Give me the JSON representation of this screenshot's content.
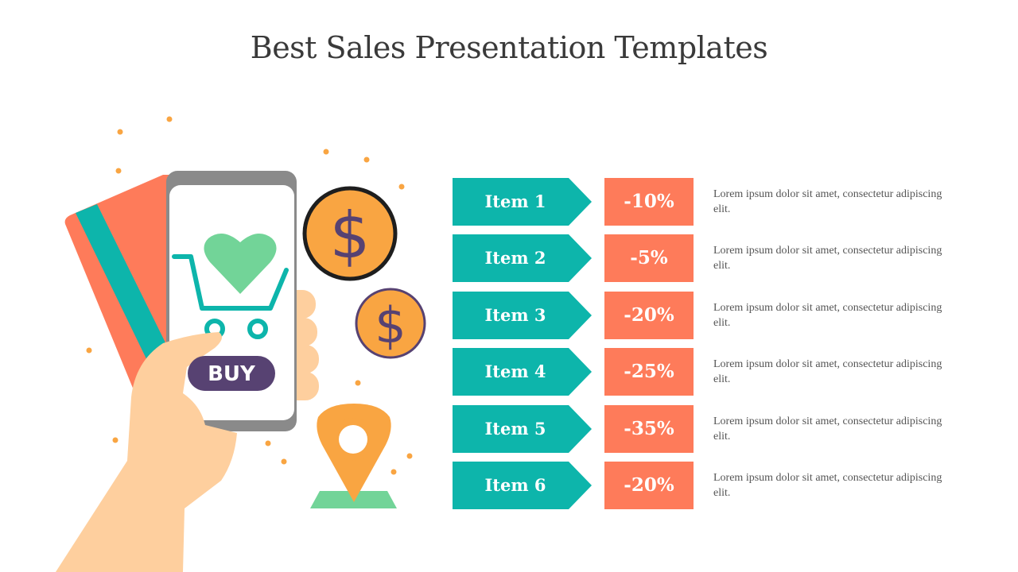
{
  "slide": {
    "title": "Best Sales Presentation Templates",
    "illustration": {
      "buy_button_label": "BUY",
      "coin_symbol": "$",
      "colors": {
        "teal": "#0db5ab",
        "coral": "#fe7b5a",
        "orange": "#f9a542",
        "purple": "#574272",
        "green": "#72d498",
        "skin": "#fecf9e",
        "phone_frame": "#8a8a8a"
      }
    },
    "items": [
      {
        "label": "Item 1",
        "discount": "-10%",
        "description": "Lorem ipsum dolor sit amet, consectetur adipiscing elit."
      },
      {
        "label": "Item 2",
        "discount": "-5%",
        "description": "Lorem ipsum dolor sit amet, consectetur adipiscing elit."
      },
      {
        "label": "Item 3",
        "discount": "-20%",
        "description": "Lorem ipsum dolor sit amet, consectetur adipiscing elit."
      },
      {
        "label": "Item 4",
        "discount": "-25%",
        "description": "Lorem ipsum dolor sit amet, consectetur adipiscing elit."
      },
      {
        "label": "Item 5",
        "discount": "-35%",
        "description": "Lorem ipsum dolor sit amet, consectetur adipiscing elit."
      },
      {
        "label": "Item 6",
        "discount": "-20%",
        "description": "Lorem ipsum dolor sit amet, consectetur adipiscing elit."
      }
    ]
  }
}
